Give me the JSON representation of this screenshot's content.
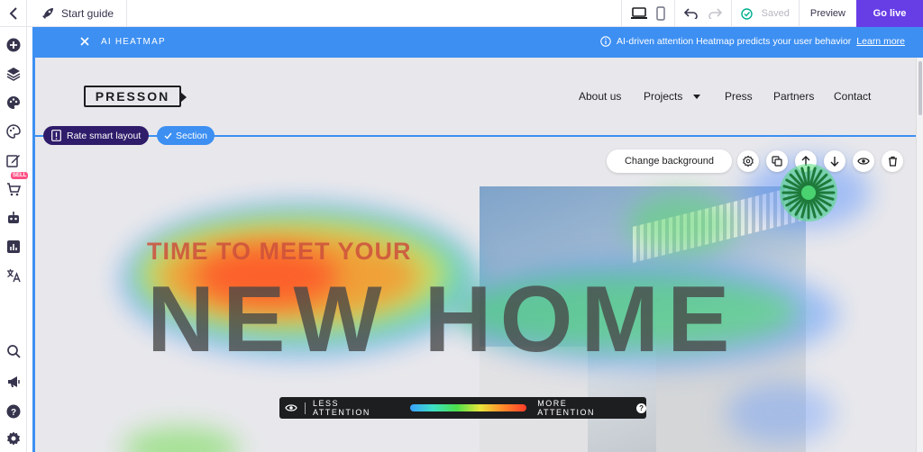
{
  "topbar": {
    "start_guide": "Start guide",
    "saved": "Saved",
    "preview": "Preview",
    "go_live": "Go live"
  },
  "sidebar": {
    "icons": [
      "add-icon",
      "layers-icon",
      "palette-icon",
      "theme-icon",
      "edit-icon",
      "cart-icon",
      "robot-icon",
      "analytics-icon",
      "translate-icon",
      "search-icon",
      "megaphone-icon",
      "help-icon",
      "settings-icon"
    ],
    "sell_badge": "SELL"
  },
  "heatmap_bar": {
    "title": "AI HEATMAP",
    "info": "AI-driven attention Heatmap predicts your user behavior",
    "learn_more": "Learn more"
  },
  "site": {
    "logo": "PRESSON",
    "nav": [
      "About us",
      "Projects",
      "Press",
      "Partners",
      "Contact"
    ],
    "hero_small": "TIME TO MEET YOUR",
    "hero_big": "NEW HOME"
  },
  "editor": {
    "rate_layout": "Rate smart layout",
    "section": "Section",
    "change_background": "Change background"
  },
  "legend": {
    "less": "LESS ATTENTION",
    "more": "MORE ATTENTION",
    "help": "?"
  },
  "colors": {
    "accent": "#673de6",
    "heatmap_blue": "#3d8ff2",
    "dark": "#1d1e20"
  }
}
